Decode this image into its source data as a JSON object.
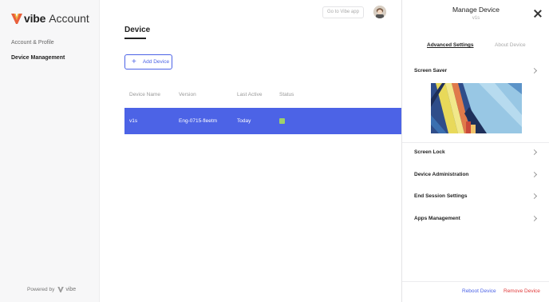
{
  "app": {
    "brand": "vibe",
    "brand_suffix": "Account",
    "powered_by": "Powered by",
    "powered_brand": "vibe"
  },
  "sidebar": {
    "items": [
      {
        "label": "Account & Profile"
      },
      {
        "label": "Device Management"
      }
    ]
  },
  "topbar": {
    "go_app_label": "Go to Vibe app"
  },
  "main": {
    "title": "Device",
    "add_button_label": "Add Device",
    "table": {
      "columns": [
        "Device Name",
        "Version",
        "Last Active",
        "Status"
      ],
      "rows": [
        {
          "name": "v1s",
          "version": "Eng-0715-fleetm",
          "last_active": "Today",
          "status": "online"
        }
      ]
    }
  },
  "panel": {
    "title": "Manage Device",
    "subtitle": "v1s",
    "tabs": [
      {
        "label": "Advanced Settings"
      },
      {
        "label": "About Device"
      }
    ],
    "sections": [
      {
        "label": "Screen Saver"
      },
      {
        "label": "Screen Lock"
      },
      {
        "label": "Device Administration"
      },
      {
        "label": "End Session Settings"
      },
      {
        "label": "Apps Management"
      }
    ],
    "reboot_label": "Reboot Device",
    "remove_label": "Remove Device"
  },
  "colors": {
    "accent": "#4c63e6",
    "danger": "#e03a3a",
    "status_online": "#9ed06a"
  }
}
